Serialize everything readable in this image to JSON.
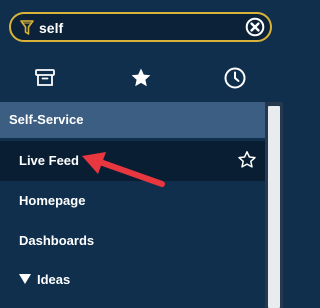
{
  "search": {
    "value": "self",
    "filter_icon": "filter-funnel-icon",
    "clear_icon": "clear-circle-x-icon"
  },
  "tabs": [
    {
      "icon": "archive-box-icon"
    },
    {
      "icon": "star-icon"
    },
    {
      "icon": "clock-icon"
    }
  ],
  "section": {
    "label": "Self-Service"
  },
  "items": [
    {
      "label": "Live Feed",
      "selected": true
    },
    {
      "label": "Homepage"
    },
    {
      "label": "Dashboards"
    },
    {
      "label": "Ideas",
      "expanded": true
    }
  ],
  "colors": {
    "accent": "#d9b23a",
    "background": "#0f2f4c",
    "section": "#3c5e82",
    "selected": "#0a1e33",
    "annotation_arrow": "#e8373f"
  }
}
